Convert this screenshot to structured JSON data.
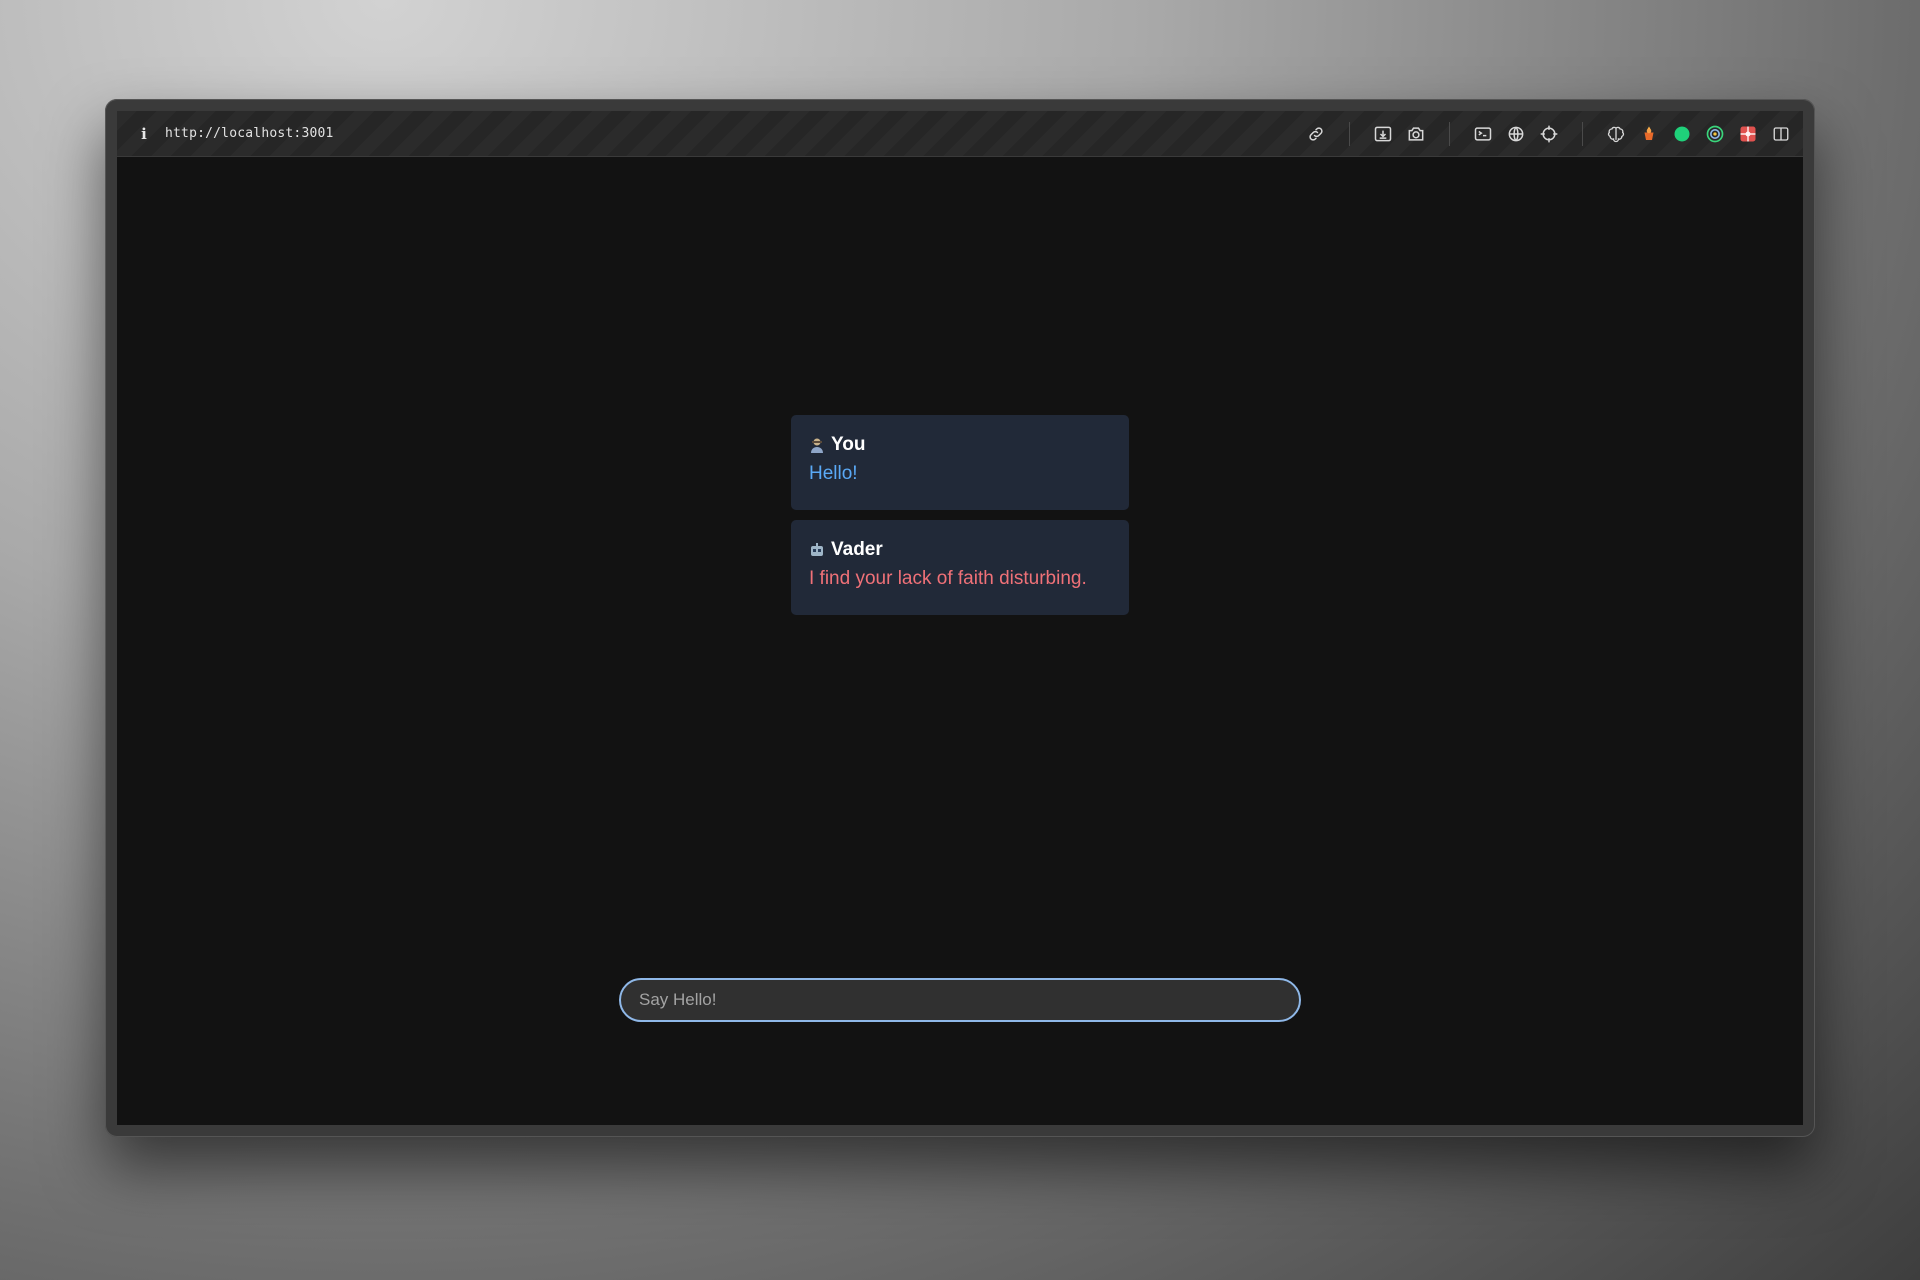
{
  "browser": {
    "info_icon": "info-icon",
    "url": "http://localhost:3001",
    "tools": [
      "link-icon",
      "download-screen-icon",
      "camera-icon",
      "terminal-icon",
      "globe-icon",
      "crosshair-icon",
      "brain-icon",
      "fox-icon",
      "green-dot-icon",
      "target-icon",
      "gift-icon",
      "split-panel-icon"
    ]
  },
  "chat": {
    "messages": [
      {
        "sender": "You",
        "text": "Hello!",
        "avatar": "user-avatar-icon"
      },
      {
        "sender": "Vader",
        "text": "I find your lack of faith disturbing.",
        "avatar": "robot-avatar-icon"
      }
    ],
    "input": {
      "placeholder": "Say Hello!",
      "value": ""
    }
  },
  "colors": {
    "background": "#121212",
    "bubble": "#212938",
    "user_text": "#5aa9f6",
    "bot_text": "#f07178",
    "input_border": "#8fb8e8"
  }
}
